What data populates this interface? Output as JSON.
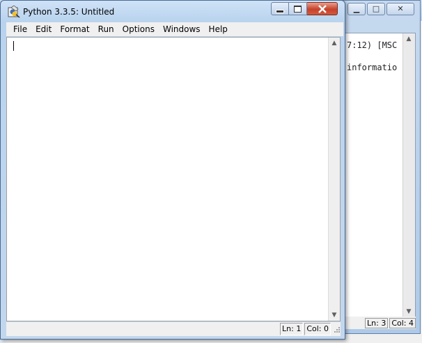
{
  "main_window": {
    "title": "Python 3.3.5: Untitled",
    "menu": [
      "File",
      "Edit",
      "Format",
      "Run",
      "Options",
      "Windows",
      "Help"
    ],
    "editor_text": "",
    "status": {
      "line": "Ln: 1",
      "col": "Col: 0"
    }
  },
  "shell_window": {
    "visible_text": [
      "7:12) [MSC",
      "informatio"
    ],
    "status": {
      "line": "Ln: 3",
      "col": "Col: 4"
    }
  },
  "colors": {
    "titlebar": "#b9d3ee",
    "close_button": "#c6412a",
    "menubar": "#f0f0f0",
    "editor": "#ffffff"
  },
  "icons": {
    "app": "python-idle-icon",
    "minimize": "minimize-icon",
    "maximize": "maximize-icon",
    "close": "close-icon"
  }
}
